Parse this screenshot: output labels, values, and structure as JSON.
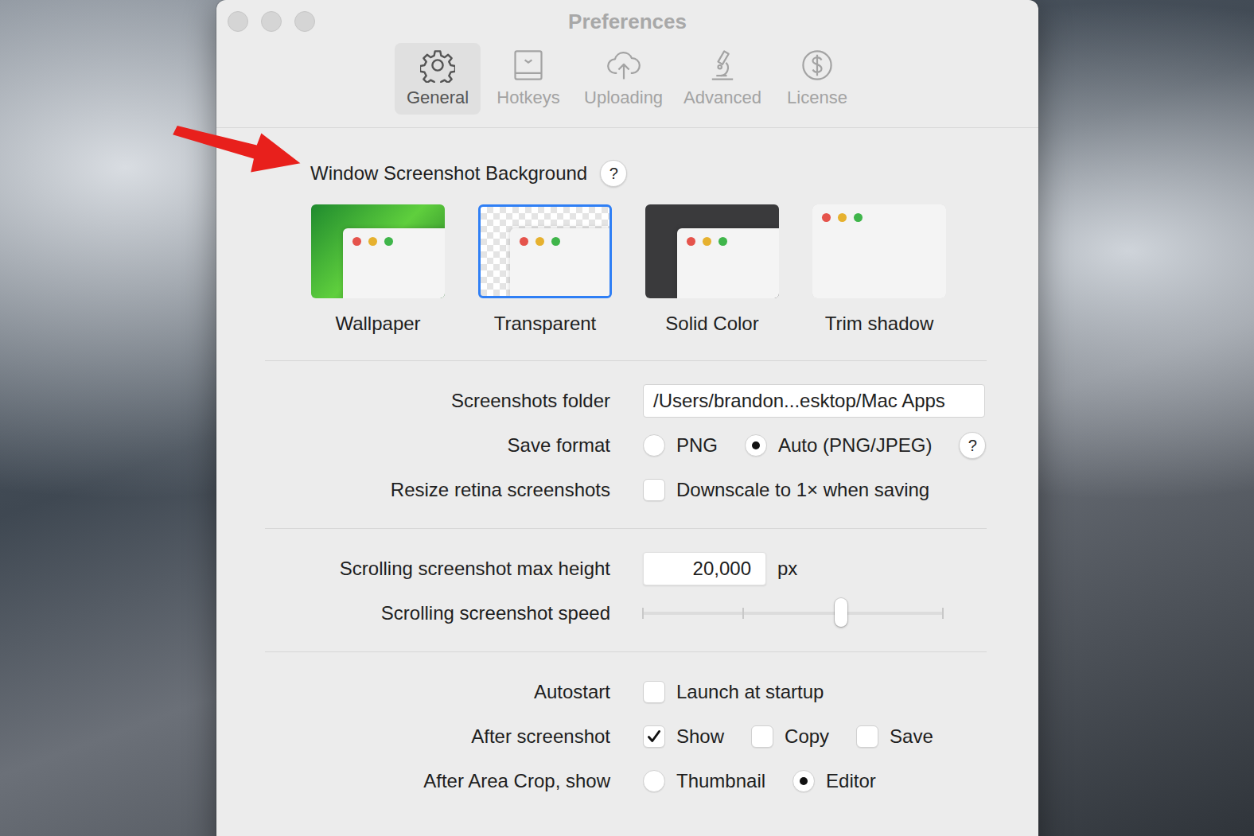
{
  "window": {
    "title": "Preferences"
  },
  "tabs": [
    {
      "label": "General",
      "selected": true
    },
    {
      "label": "Hotkeys",
      "selected": false
    },
    {
      "label": "Uploading",
      "selected": false
    },
    {
      "label": "Advanced",
      "selected": false
    },
    {
      "label": "License",
      "selected": false
    }
  ],
  "background": {
    "heading": "Window Screenshot Background",
    "help": "?",
    "options": [
      {
        "label": "Wallpaper",
        "kind": "wallpaper",
        "selected": false
      },
      {
        "label": "Transparent",
        "kind": "transparent",
        "selected": true
      },
      {
        "label": "Solid Color",
        "kind": "solid",
        "selected": false
      },
      {
        "label": "Trim shadow",
        "kind": "trim",
        "selected": false
      }
    ]
  },
  "sections": [
    {
      "rows": [
        {
          "label": "Screenshots folder",
          "kind": "field",
          "value": "/Users/brandon...esktop/Mac Apps"
        },
        {
          "label": "Save format",
          "kind": "radios",
          "options": [
            {
              "label": "PNG",
              "selected": false
            },
            {
              "label": "Auto (PNG/JPEG)",
              "selected": true
            }
          ],
          "help": "?"
        },
        {
          "label": "Resize retina screenshots",
          "kind": "checkboxes",
          "options": [
            {
              "label": "Downscale to 1× when saving",
              "checked": false
            }
          ]
        }
      ]
    },
    {
      "rows": [
        {
          "label": "Scrolling screenshot max height",
          "kind": "number",
          "value": "20,000",
          "unit": "px"
        },
        {
          "label": "Scrolling screenshot speed",
          "kind": "slider",
          "level": 0.66
        }
      ]
    },
    {
      "rows": [
        {
          "label": "Autostart",
          "kind": "checkboxes",
          "options": [
            {
              "label": "Launch at startup",
              "checked": false
            }
          ]
        },
        {
          "label": "After screenshot",
          "kind": "checkboxes",
          "options": [
            {
              "label": "Show",
              "checked": true
            },
            {
              "label": "Copy",
              "checked": false
            },
            {
              "label": "Save",
              "checked": false
            }
          ]
        },
        {
          "label": "After Area Crop, show",
          "kind": "radios",
          "options": [
            {
              "label": "Thumbnail",
              "selected": false
            },
            {
              "label": "Editor",
              "selected": true
            }
          ]
        }
      ]
    }
  ]
}
